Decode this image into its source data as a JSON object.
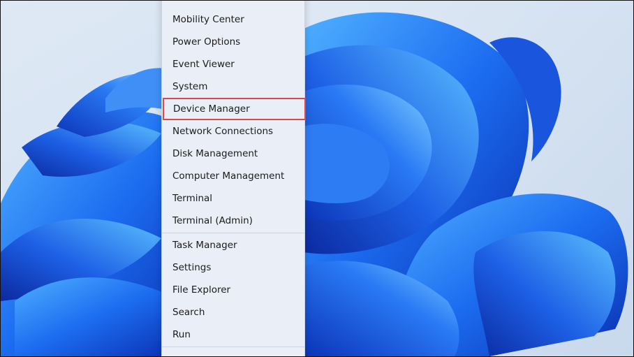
{
  "menu": {
    "items_group1": [
      {
        "label": "Mobility Center"
      },
      {
        "label": "Power Options"
      },
      {
        "label": "Event Viewer"
      },
      {
        "label": "System"
      },
      {
        "label": "Device Manager",
        "highlighted": true
      },
      {
        "label": "Network Connections"
      },
      {
        "label": "Disk Management"
      },
      {
        "label": "Computer Management"
      },
      {
        "label": "Terminal"
      },
      {
        "label": "Terminal (Admin)"
      }
    ],
    "items_group2": [
      {
        "label": "Task Manager"
      },
      {
        "label": "Settings"
      },
      {
        "label": "File Explorer"
      },
      {
        "label": "Search"
      },
      {
        "label": "Run"
      }
    ]
  },
  "colors": {
    "highlight_border": "#e0464a",
    "menu_background": "#e9eef7",
    "wallpaper_base": "#d9e6f3",
    "bloom_blue": "#1f5ee8"
  }
}
